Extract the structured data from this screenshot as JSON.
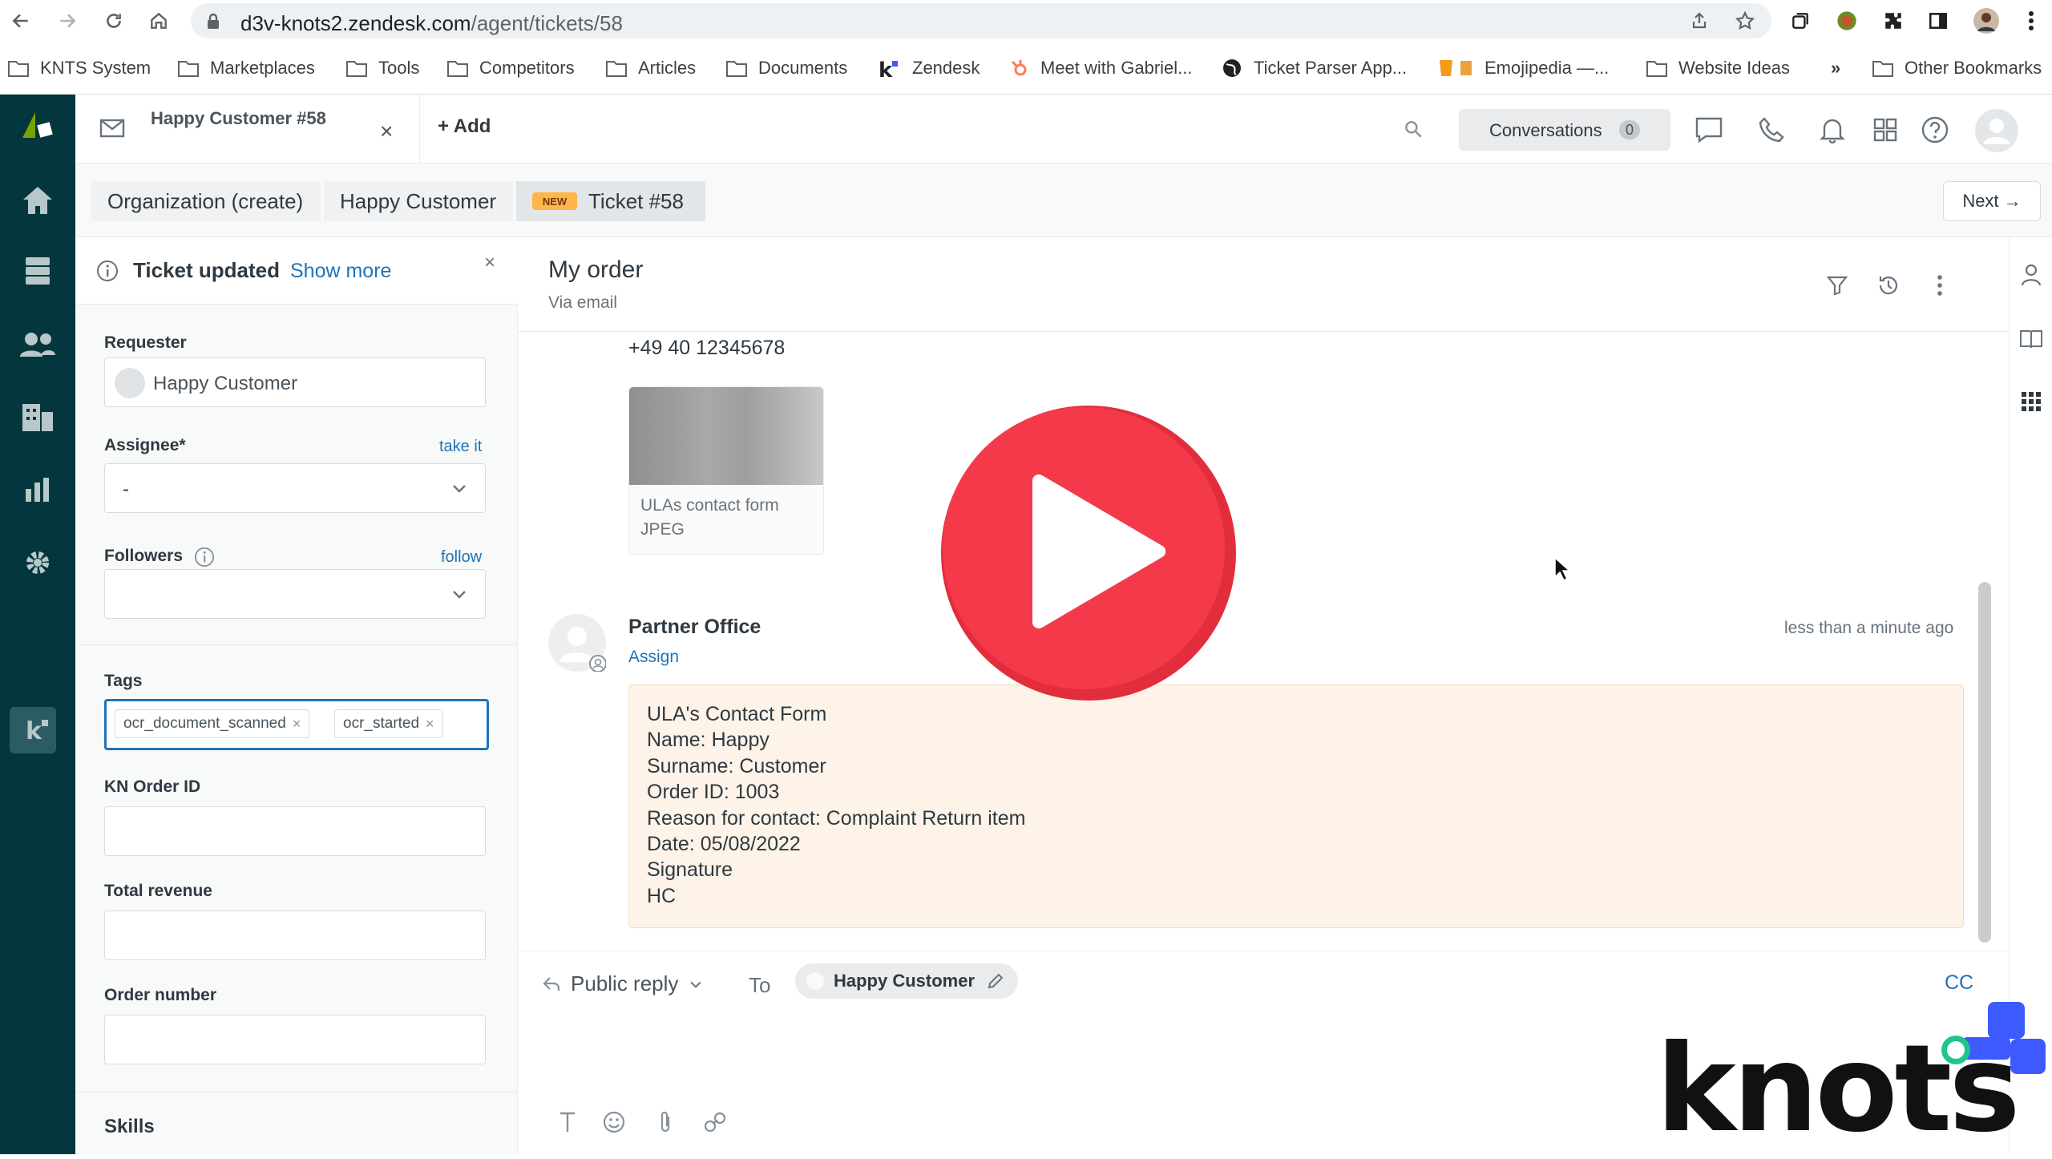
{
  "browser": {
    "url_host": "d3v-knots2.zendesk.com",
    "url_path": "/agent/tickets/58",
    "bookmarks": [
      {
        "label": "KNTS System"
      },
      {
        "label": "Marketplaces"
      },
      {
        "label": "Tools"
      },
      {
        "label": "Competitors"
      },
      {
        "label": "Articles"
      },
      {
        "label": "Documents"
      },
      {
        "label": "Zendesk"
      },
      {
        "label": "Meet with Gabriel..."
      },
      {
        "label": "Ticket Parser App..."
      },
      {
        "label": "Emojipedia —..."
      },
      {
        "label": "Website Ideas"
      },
      {
        "label": "»"
      },
      {
        "label": "Other Bookmarks"
      }
    ]
  },
  "appbar": {
    "tab_title": "Happy Customer #58",
    "tab_close": "×",
    "add_label": "+ Add",
    "conversations_label": "Conversations",
    "conversations_count": "0"
  },
  "crumbs": {
    "org": "Organization (create)",
    "user": "Happy Customer",
    "badge": "NEW",
    "ticket": "Ticket #58",
    "next": "Next →"
  },
  "leftpanel": {
    "notice_title": "Ticket updated",
    "notice_more": "Show more",
    "notice_close": "×",
    "requester_label": "Requester",
    "requester_value": "Happy Customer",
    "assignee_label": "Assignee*",
    "assignee_link": "take it",
    "assignee_value": "-",
    "followers_label": "Followers",
    "followers_link": "follow",
    "tags_label": "Tags",
    "tags": [
      {
        "label": "ocr_document_scanned"
      },
      {
        "label": "ocr_started"
      }
    ],
    "kn_order_label": "KN Order ID",
    "total_revenue_label": "Total revenue",
    "order_number_label": "Order number",
    "skills_label": "Skills"
  },
  "conversation": {
    "subject": "My order",
    "via": "Via email",
    "phone": "+49 40 12345678",
    "attachment_name": "ULAs contact form",
    "attachment_type": "JPEG",
    "author": "Partner Office",
    "assign": "Assign",
    "time": "less than a minute ago",
    "body_lines": [
      "ULA's Contact Form",
      "Name: Happy",
      "Surname: Customer",
      "Order ID: 1003",
      "Reason for contact: Complaint Return item",
      "Date: 05/08/2022",
      "Signature",
      "HC"
    ]
  },
  "reply": {
    "type": "Public reply",
    "to_label": "To",
    "to_value": "Happy Customer",
    "cc": "CC"
  },
  "brand": {
    "wordmark": "knots",
    "accent": "#3d5afe",
    "play_color": "#f43a4a"
  }
}
